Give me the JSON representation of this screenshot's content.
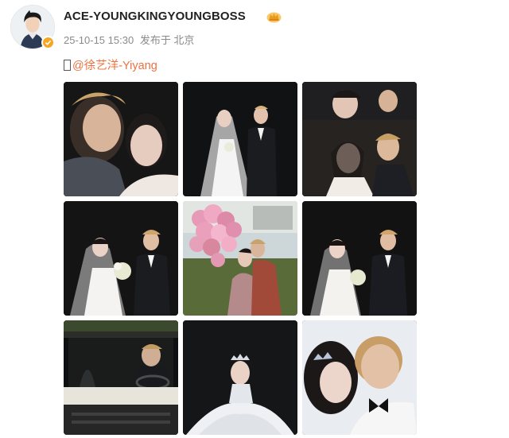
{
  "header": {
    "username": "ACE-YOUNGKINGYOUNGBOSS",
    "timestamp": "25-10-15 15:30",
    "location": "发布于 北京",
    "avatar_icon": "user-avatar",
    "verified_icon": "verified-badge-icon",
    "crown_icon": "crown-icon"
  },
  "post": {
    "missing_glyph": "",
    "mention": "@徐艺洋-Yiyang"
  },
  "photos": [
    {
      "name": "photo-1"
    },
    {
      "name": "photo-2"
    },
    {
      "name": "photo-3"
    },
    {
      "name": "photo-4"
    },
    {
      "name": "photo-5"
    },
    {
      "name": "photo-6"
    },
    {
      "name": "photo-7"
    },
    {
      "name": "photo-8"
    },
    {
      "name": "photo-9"
    }
  ],
  "colors": {
    "mention": "#eb7340",
    "meta_text": "#8a8a8a",
    "verified": "#f5a623"
  }
}
